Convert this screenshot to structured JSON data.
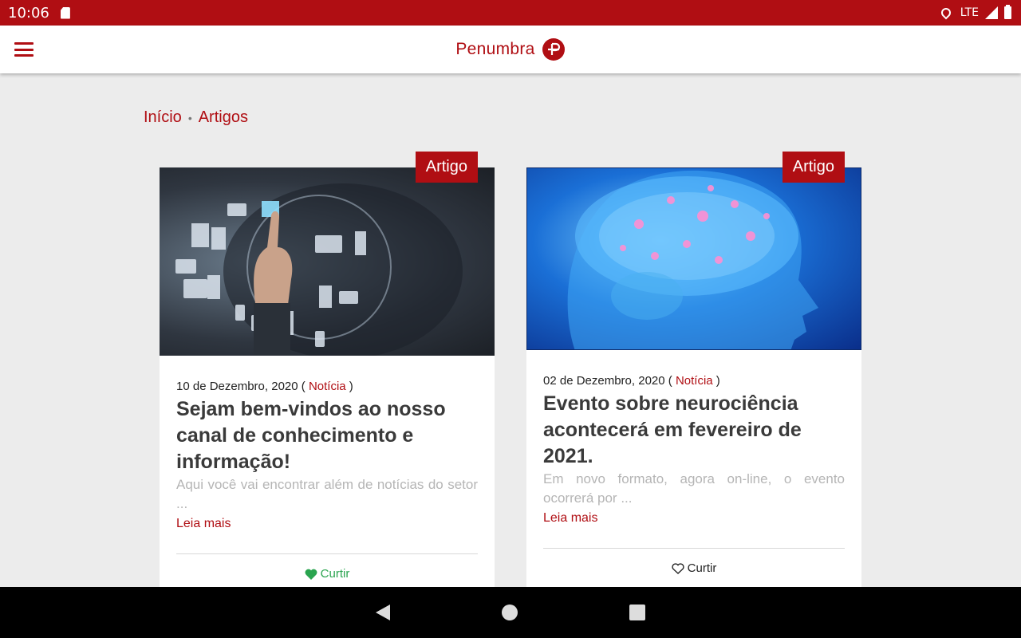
{
  "status_bar": {
    "time": "10:06",
    "network": "LTE",
    "icons": [
      "sd-card-icon",
      "location-icon",
      "signal-icon",
      "battery-icon"
    ]
  },
  "app_bar": {
    "logo_text": "Penumbra",
    "brand_color": "#b00e13",
    "icons": [
      "menu-icon",
      "logo-mark-icon"
    ]
  },
  "breadcrumb": {
    "home": "Início",
    "separator": "•",
    "current": "Artigos"
  },
  "cards": [
    {
      "badge": "Artigo",
      "date": "10 de Dezembro, 2020",
      "category": "Notícia",
      "title": "Sejam bem-vindos ao nosso canal de conhecimento e informação!",
      "excerpt": "Aqui você vai encontrar além de notícias do setor ...",
      "read_more": "Leia mais",
      "like_label": "Curtir",
      "liked": true,
      "image": "digital-network-touch-image"
    },
    {
      "badge": "Artigo",
      "date": "02 de Dezembro, 2020",
      "category": "Notícia",
      "title": "Evento sobre neurociência acontecerá em fevereiro de 2021.",
      "excerpt": "Em novo formato, agora on-line, o evento ocorrerá por ...",
      "read_more": "Leia mais",
      "like_label": "Curtir",
      "liked": false,
      "image": "glowing-brain-image"
    }
  ],
  "nav_bar": {
    "icons": [
      "back-icon",
      "home-icon",
      "recents-icon"
    ]
  }
}
